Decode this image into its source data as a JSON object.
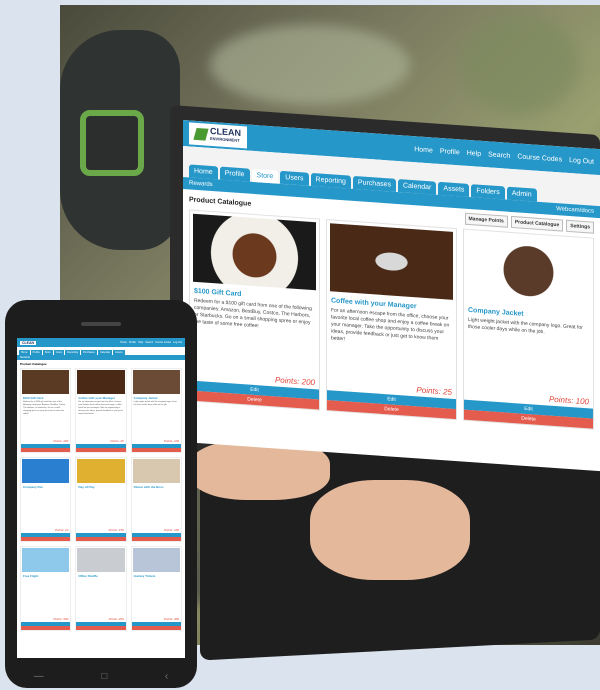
{
  "app": {
    "logo_title": "CLEAN",
    "logo_subtitle": "ENVIRONMENT"
  },
  "top_nav": [
    "Home",
    "Profile",
    "Help",
    "Search",
    "Course Codes",
    "Log Out"
  ],
  "tabs": [
    "Home",
    "Profile",
    "Store",
    "Users",
    "Reporting",
    "Purchases",
    "Calendar",
    "Assets",
    "Folders",
    "Admin"
  ],
  "subbar": {
    "label": "Rewards",
    "right": "Webcam/docs"
  },
  "panel": {
    "title": "Product Catalogue"
  },
  "toolbar": {
    "manage_points": "Manage Points",
    "product_catalogue": "Product Catalogue",
    "settings": "Settings"
  },
  "products": [
    {
      "title": "$100 Gift Card",
      "description": "Redeem for a $100 gift card from one of the following companies: Amazon, BestBuy, Costco, The Harbors, or Starbucks. Go on a small shopping spree or enjoy the taste of some free coffee!",
      "points": "Points: 200",
      "edit": "Edit",
      "delete": "Delete"
    },
    {
      "title": "Coffee with your Manager",
      "description": "For an afternoon escape from the office, choose your favorite local coffee shop and enjoy a coffee break on your manager. Take the opportunity to discuss your ideas, provide feedback or just get to know them better!",
      "points": "Points: 25",
      "edit": "Edit",
      "delete": "Delete"
    },
    {
      "title": "Company Jacket",
      "description": "Light weight jacket with the company logo. Great for those cooler days while on the job.",
      "points": "Points: 100",
      "edit": "Edit",
      "delete": "Delete"
    }
  ],
  "mobile_products": [
    {
      "title": "$100 Gift Card",
      "points": "Points: 200"
    },
    {
      "title": "Coffee with your Manager",
      "points": "Points: 25"
    },
    {
      "title": "Company Jacket",
      "points": "Points: 100"
    },
    {
      "title": "Company Pen",
      "points": "Points: 10"
    },
    {
      "title": "Day off Pay",
      "points": "Points: 150"
    },
    {
      "title": "Dinner with the Boss",
      "points": "Points: 100"
    },
    {
      "title": "Free Flight",
      "points": "Points: 500"
    },
    {
      "title": "Office Shuffle",
      "points": "Points: 200"
    },
    {
      "title": "Hockey Tickets",
      "points": "Points: 300"
    }
  ],
  "phone_nav": {
    "back": "‹",
    "home": "□",
    "recent": "—"
  }
}
